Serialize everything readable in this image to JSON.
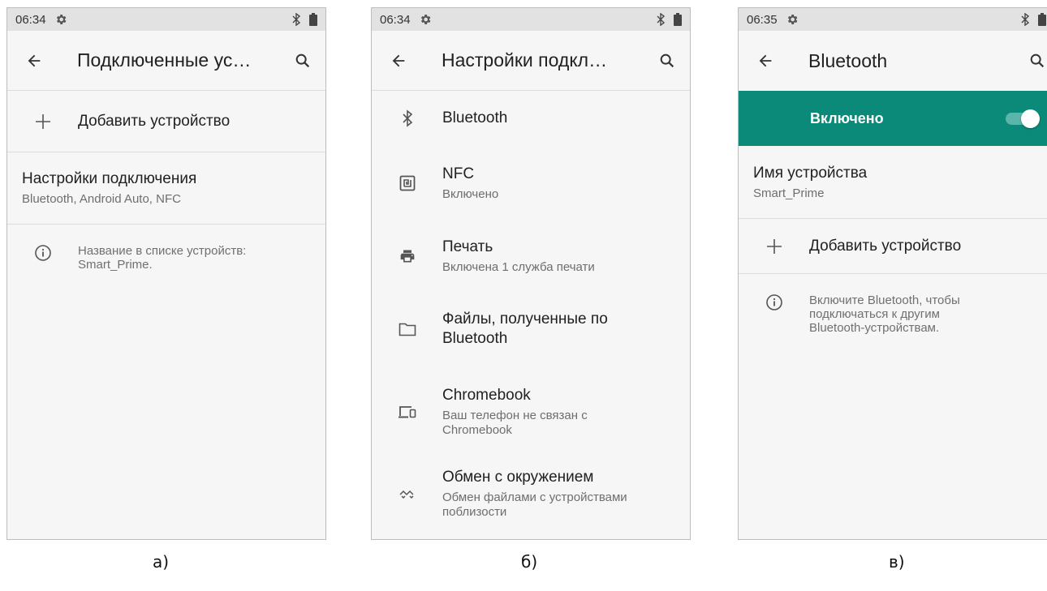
{
  "screens": [
    {
      "status_time": "06:34",
      "title": "Подключенные ус…",
      "add_device": "Добавить устройство",
      "connection_settings": {
        "title": "Настройки подключения",
        "subtitle": "Bluetooth, Android Auto, NFC"
      },
      "info_text": "Название в списке устройств: Smart_Prime.",
      "caption": "а)"
    },
    {
      "status_time": "06:34",
      "title": "Настройки подкл…",
      "items": [
        {
          "icon": "bluetooth-icon",
          "title": "Bluetooth",
          "subtitle": ""
        },
        {
          "icon": "nfc-icon",
          "title": "NFC",
          "subtitle": "Включено"
        },
        {
          "icon": "printer-icon",
          "title": "Печать",
          "subtitle": "Включена 1 служба печати"
        },
        {
          "icon": "folder-icon",
          "title": "Файлы, полученные по Bluetooth",
          "subtitle": ""
        },
        {
          "icon": "devices-icon",
          "title": "Chromebook",
          "subtitle": "Ваш телефон не связан с Chromebook"
        },
        {
          "icon": "nearby-share-icon",
          "title": "Обмен с окружением",
          "subtitle": "Обмен файлами с устройствами поблизости"
        }
      ],
      "caption": "б)"
    },
    {
      "status_time": "06:35",
      "title": "Bluetooth",
      "toggle_label": "Включено",
      "toggle_on": true,
      "device_name": {
        "title": "Имя устройства",
        "value": "Smart_Prime"
      },
      "add_device": "Добавить устройство",
      "info_text": "Включите Bluetooth, чтобы подключаться к другим Bluetooth-устройствам.",
      "caption": "в)"
    }
  ],
  "colors": {
    "accent": "#0b8a7a",
    "background": "#f6f6f6",
    "statusbar": "#e2e2e2"
  }
}
